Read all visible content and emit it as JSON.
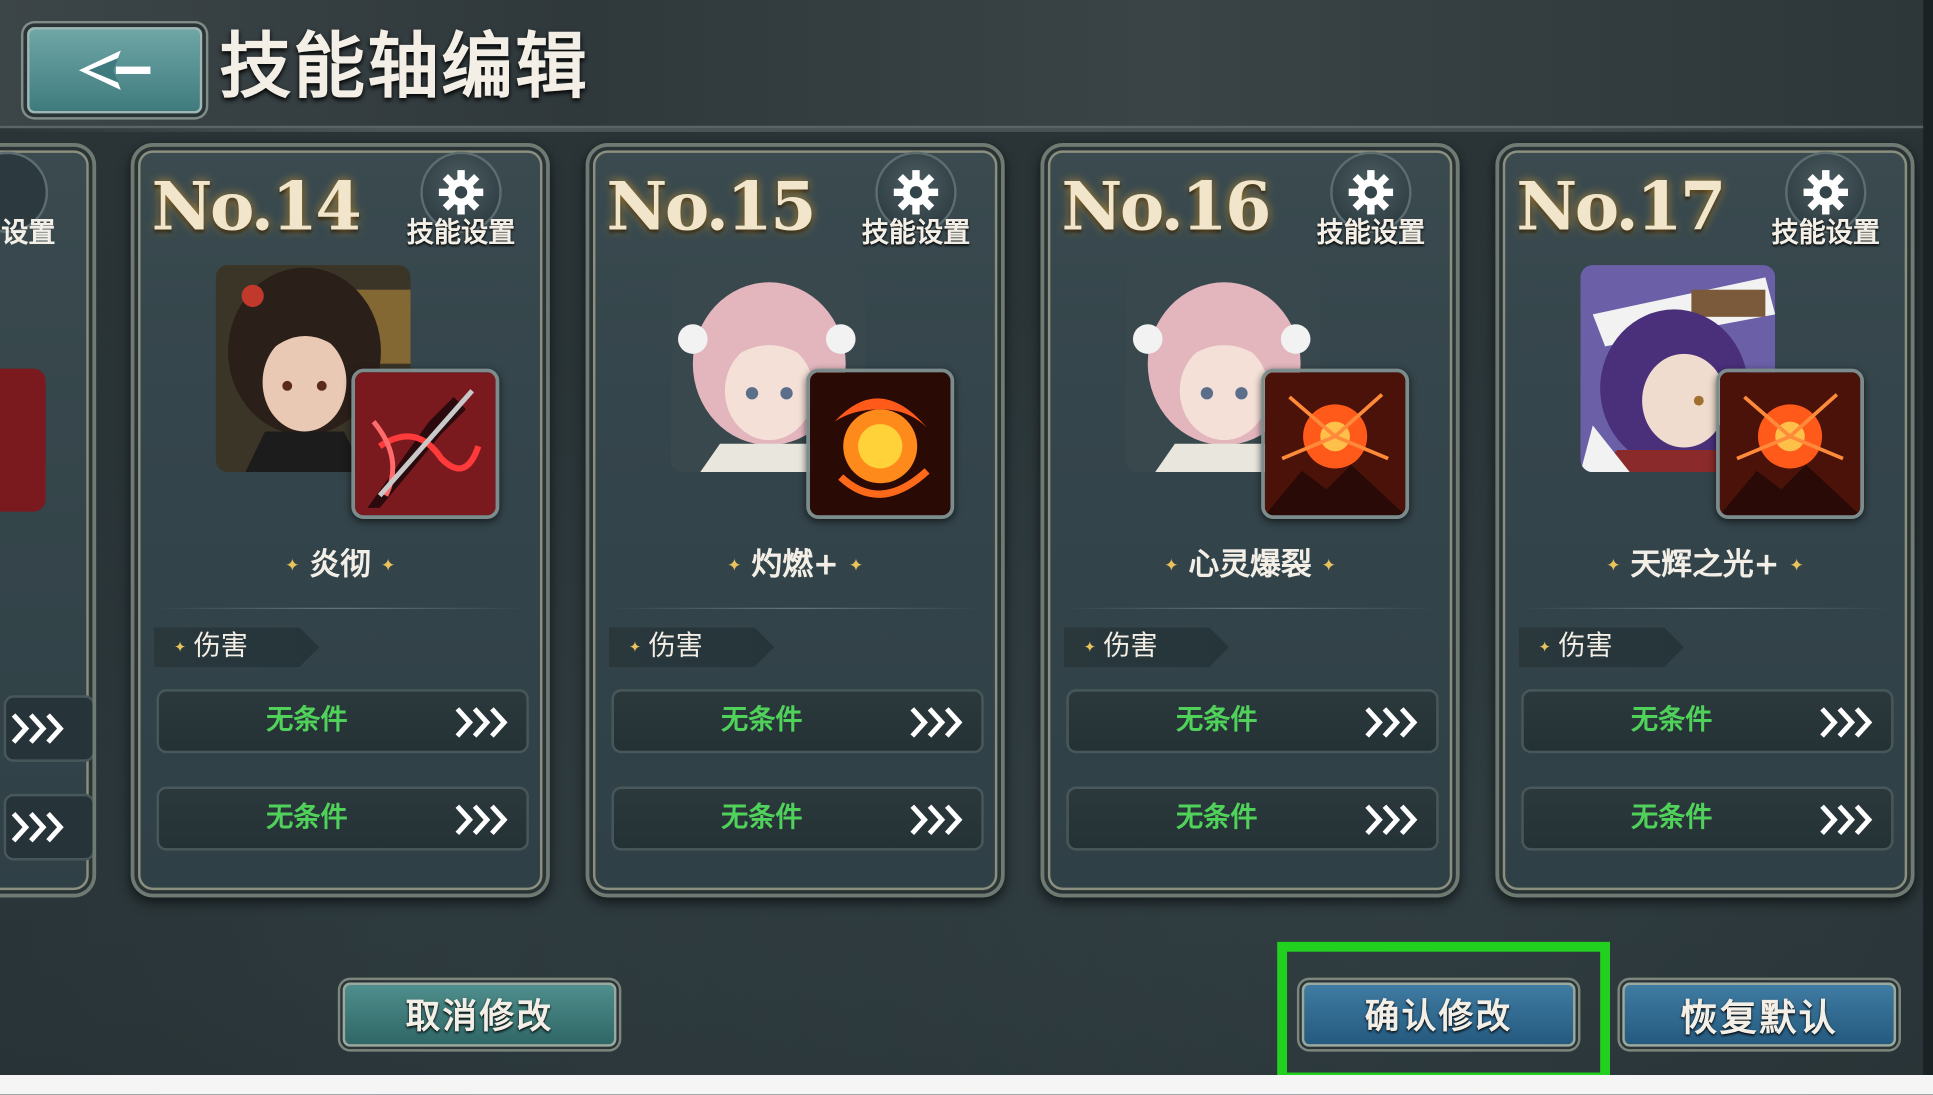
{
  "header": {
    "title": "技能轴编辑",
    "back_icon": "back-arrow-icon"
  },
  "partial_card": {
    "setting_label": "设置"
  },
  "cards": [
    {
      "number": "No.14",
      "setting_label": "技能设置",
      "skill_name": "炎彻",
      "tag": "伤害",
      "conditions": [
        "无条件",
        "无条件"
      ],
      "colors": {
        "skill_bg": "#7a1a1f",
        "skill_fg": "#ff3a3a",
        "hair": "#2b1f1a",
        "portrait_bg": "#3b3528"
      }
    },
    {
      "number": "No.15",
      "setting_label": "技能设置",
      "skill_name": "灼燃+",
      "tag": "伤害",
      "conditions": [
        "无条件",
        "无条件"
      ],
      "colors": {
        "skill_bg": "#2a0a05",
        "skill_fg": "#ff8a1c",
        "hair": "#e3b6be",
        "portrait_bg": "#39484d"
      }
    },
    {
      "number": "No.16",
      "setting_label": "技能设置",
      "skill_name": "心灵爆裂",
      "tag": "伤害",
      "conditions": [
        "无条件",
        "无条件"
      ],
      "colors": {
        "skill_bg": "#4a1208",
        "skill_fg": "#ff5a1a",
        "hair": "#e3b6be",
        "portrait_bg": "#39484d"
      }
    },
    {
      "number": "No.17",
      "setting_label": "技能设置",
      "skill_name": "天辉之光+",
      "tag": "伤害",
      "conditions": [
        "无条件",
        "无条件"
      ],
      "colors": {
        "skill_bg": "#4a1208",
        "skill_fg": "#ff5a1a",
        "hair": "#4a2f7a",
        "portrait_bg": "#6b5fa8"
      }
    }
  ],
  "buttons": {
    "cancel": "取消修改",
    "confirm": "确认修改",
    "reset": "恢复默认"
  },
  "colors": {
    "condition_text": "#4fd15a",
    "highlight": "#22d020",
    "accent_gold": "#e8c35c"
  }
}
